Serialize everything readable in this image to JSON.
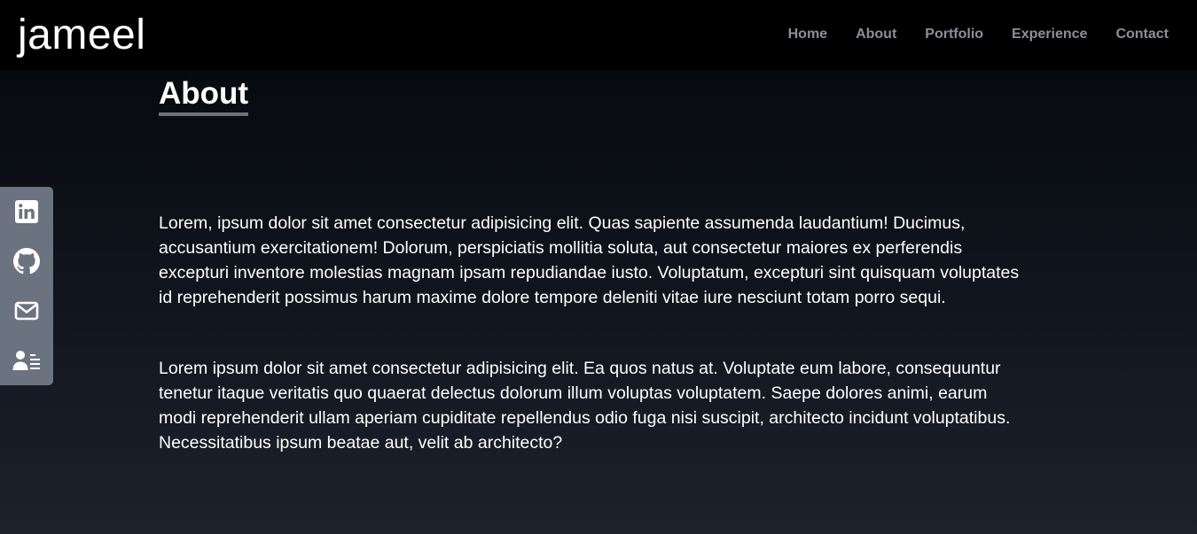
{
  "navbar": {
    "brand": "jameel",
    "links": [
      "Home",
      "About",
      "Portfolio",
      "Experience",
      "Contact"
    ]
  },
  "about": {
    "title": "About",
    "paragraphs": [
      "Lorem, ipsum dolor sit amet consectetur adipisicing elit. Quas sapiente assumenda laudantium! Ducimus, accusantium exercitationem! Dolorum, perspiciatis mollitia soluta, aut consectetur maiores ex perferendis excepturi inventore molestias magnam ipsam repudiandae iusto. Voluptatum, excepturi sint quisquam voluptates id reprehenderit possimus harum maxime dolore tempore deleniti vitae iure nesciunt totam porro sequi.",
      "Lorem ipsum dolor sit amet consectetur adipisicing elit. Ea quos natus at. Voluptate eum labore, consequuntur tenetur itaque veritatis quo quaerat delectus dolorum illum voluptas voluptatem. Saepe dolores animi, earum modi reprehenderit ullam aperiam cupiditate repellendus odio fuga nisi suscipit, architecto incidunt voluptatibus. Necessitatibus ipsum beatae aut, velit ab architecto?"
    ]
  },
  "social": {
    "icons": [
      "linkedin-icon",
      "github-icon",
      "mail-icon",
      "resume-icon"
    ]
  },
  "colors": {
    "navbar_bg": "#000000",
    "nav_link": "#8a9099",
    "sidebar_bg": "#6b7280",
    "text": "#ffffff"
  }
}
